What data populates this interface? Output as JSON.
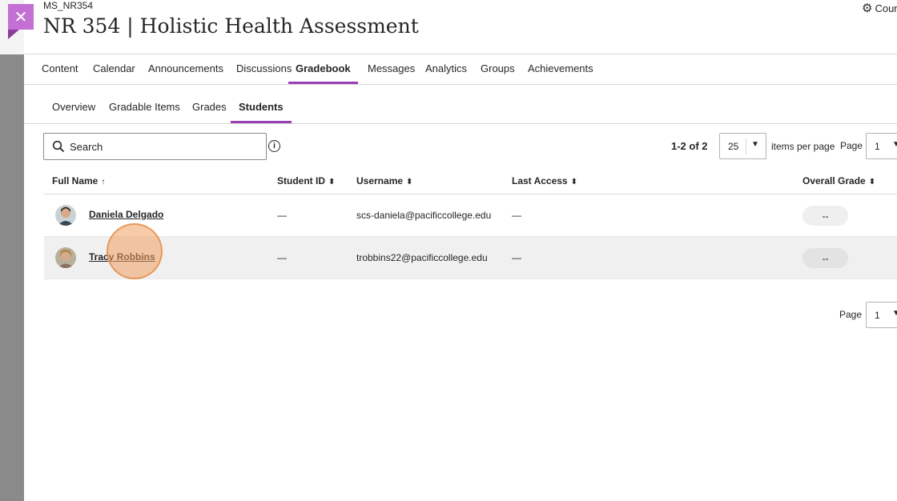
{
  "course": {
    "code": "MS_NR354",
    "title": "NR 354 | Holistic Health Assessment",
    "settings_label": "Course"
  },
  "topnav": {
    "tabs": [
      {
        "label": "Content"
      },
      {
        "label": "Calendar"
      },
      {
        "label": "Announcements"
      },
      {
        "label": "Discussions"
      },
      {
        "label": "Gradebook"
      },
      {
        "label": "Messages"
      },
      {
        "label": "Analytics"
      },
      {
        "label": "Groups"
      },
      {
        "label": "Achievements"
      }
    ],
    "active": "Gradebook"
  },
  "subnav": {
    "tabs": [
      {
        "label": "Overview"
      },
      {
        "label": "Gradable Items"
      },
      {
        "label": "Grades"
      },
      {
        "label": "Students"
      }
    ],
    "active": "Students"
  },
  "toolbar": {
    "search_placeholder": "Search",
    "info_glyph": "i",
    "count_text": "1-2 of 2",
    "per_page_value": "25",
    "per_page_label": "items per page",
    "page_label": "Page",
    "page_value": "1"
  },
  "table": {
    "columns": {
      "full_name": "Full Name",
      "student_id": "Student ID",
      "username": "Username",
      "last_access": "Last Access",
      "overall_grade": "Overall Grade"
    },
    "rows": [
      {
        "name": "Daniela Delgado",
        "student_id": "—",
        "username": "scs-daniela@pacificcollege.edu",
        "last_access": "—",
        "grade": "--"
      },
      {
        "name": "Tracy Robbins",
        "student_id": "—",
        "username": "trobbins22@pacificcollege.edu",
        "last_access": "—",
        "grade": "--"
      }
    ]
  },
  "footer": {
    "page_label": "Page",
    "page_value": "1"
  },
  "colors": {
    "accent": "#9b3fb5",
    "close_button": "#c36fd4"
  },
  "icons": {
    "close": "close-icon",
    "settings": "gear-icon",
    "search": "search-icon",
    "info": "info-icon",
    "sort": "sort-icon",
    "dropdown": "chevron-down-icon"
  }
}
